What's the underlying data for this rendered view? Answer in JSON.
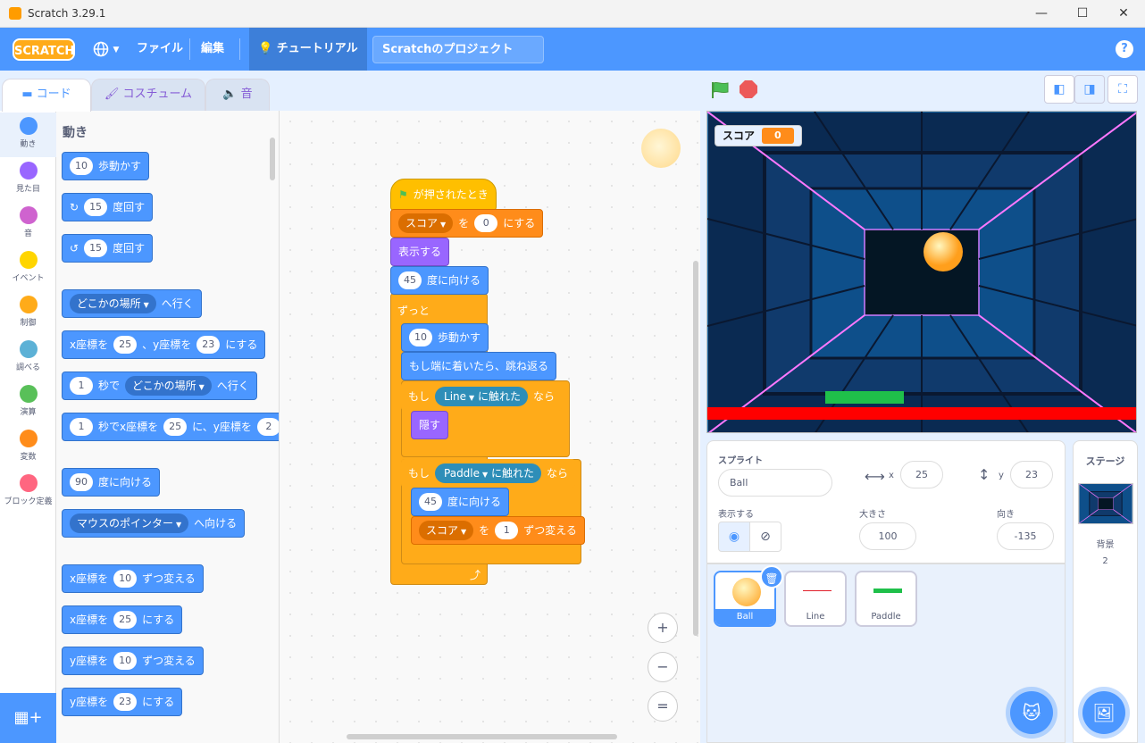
{
  "window": {
    "title": "Scratch 3.29.1",
    "controls": [
      "—",
      "☐",
      "✕"
    ]
  },
  "menubar": {
    "logo": "SCRATCH",
    "language_icon": "globe-icon",
    "file": "ファイル",
    "edit": "編集",
    "tutorials": "チュートリアル",
    "project_title": "Scratchのプロジェクト",
    "help": "?"
  },
  "tabs": {
    "code": "コード",
    "costumes": "コスチューム",
    "sounds": "音"
  },
  "categories": [
    {
      "label": "動き",
      "color": "#4c97ff"
    },
    {
      "label": "見た目",
      "color": "#9966ff"
    },
    {
      "label": "音",
      "color": "#cf63cf"
    },
    {
      "label": "イベント",
      "color": "#ffd500"
    },
    {
      "label": "制御",
      "color": "#ffab19"
    },
    {
      "label": "調べる",
      "color": "#5cb1d6"
    },
    {
      "label": "演算",
      "color": "#59c059"
    },
    {
      "label": "変数",
      "color": "#ff8c1a"
    },
    {
      "label": "ブロック定義",
      "color": "#ff6680"
    }
  ],
  "palette": {
    "title": "動き",
    "move": {
      "n": "10",
      "t": "歩動かす"
    },
    "turn_right": {
      "n": "15",
      "t": "度回す"
    },
    "turn_left": {
      "n": "15",
      "t": "度回す"
    },
    "goto": {
      "dd": "どこかの場所",
      "t": "へ行く"
    },
    "gotoxy": {
      "a": "x座標を",
      "x": "25",
      "b": "、y座標を",
      "y": "23",
      "c": "にする"
    },
    "glide": {
      "n": "1",
      "a": "秒で",
      "dd": "どこかの場所",
      "t": "へ行く"
    },
    "glidexy": {
      "n": "1",
      "a": "秒でx座標を",
      "x": "25",
      "b": "に、y座標を",
      "y": "2"
    },
    "point": {
      "n": "90",
      "t": "度に向ける"
    },
    "pointto": {
      "dd": "マウスのポインター",
      "t": "へ向ける"
    },
    "changex": {
      "a": "x座標を",
      "n": "10",
      "t": "ずつ変える"
    },
    "setx": {
      "a": "x座標を",
      "n": "25",
      "t": "にする"
    },
    "changey": {
      "a": "y座標を",
      "n": "10",
      "t": "ずつ変える"
    },
    "sety": {
      "a": "y座標を",
      "n": "23",
      "t": "にする"
    }
  },
  "script": {
    "hat": "が押されたとき",
    "set_var": {
      "dd": "スコア",
      "a": "を",
      "n": "0",
      "t": "にする"
    },
    "show": "表示する",
    "point": {
      "n": "45",
      "t": "度に向ける"
    },
    "forever": "ずっと",
    "move": {
      "n": "10",
      "t": "歩動かす"
    },
    "bounce": "もし端に着いたら、跳ね返る",
    "if1": {
      "a": "もし",
      "dd": "Line",
      "b": "に触れた",
      "c": "なら"
    },
    "hide": "隠す",
    "if2": {
      "a": "もし",
      "dd": "Paddle",
      "b": "に触れた",
      "c": "なら"
    },
    "point2": {
      "n": "45",
      "t": "度に向ける"
    },
    "change_var": {
      "dd": "スコア",
      "a": "を",
      "n": "1",
      "t": "ずつ変える"
    },
    "loop_arrow": "⤴"
  },
  "zoom": {
    "in": "+",
    "out": "−",
    "reset": "="
  },
  "stage": {
    "score_label": "スコア",
    "score_value": "0"
  },
  "sprite_info": {
    "sprite_label": "スプライト",
    "sprite_name": "Ball",
    "x_label": "x",
    "x_value": "25",
    "y_label": "y",
    "y_value": "23",
    "show_label": "表示する",
    "size_label": "大きさ",
    "size_value": "100",
    "direction_label": "向き",
    "direction_value": "-135"
  },
  "sprites": [
    {
      "name": "Ball"
    },
    {
      "name": "Line"
    },
    {
      "name": "Paddle"
    }
  ],
  "stage_pane": {
    "title": "ステージ",
    "backdrops_label": "背景",
    "backdrops_count": "2"
  }
}
